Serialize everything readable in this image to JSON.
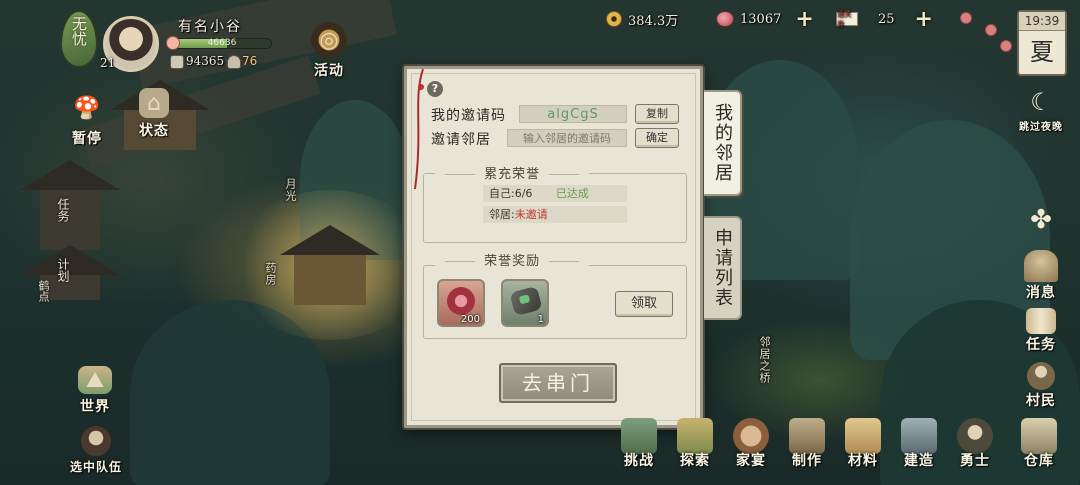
{
  "player": {
    "status_badge": "无忧",
    "name": "有名小谷",
    "level": "21",
    "exp_text": "46636",
    "exp_fraction": 0.55,
    "stat_house": "94365",
    "stat_people": "76"
  },
  "hud_left": {
    "activity": "活动",
    "pause": "暂停",
    "status": "状态",
    "task_side": "任务",
    "plan_side": "计划",
    "crane_point": "鹤点",
    "world": "世界",
    "select_team": "选中队伍"
  },
  "currency": {
    "coins": "384.3万",
    "gems": "13067",
    "tickets": "25",
    "ticket_icon_text": "通关券"
  },
  "clock": {
    "time": "19:39",
    "season": "夏"
  },
  "hud_right": {
    "skip_night": "跳过夜晚",
    "news": "消息",
    "task": "任务",
    "villagers": "村民"
  },
  "map_labels": {
    "moonlight": "月光",
    "pharmacy": "药房",
    "neighbor_bridge": "邻居之桥"
  },
  "dialog": {
    "my_code_label": "我的邀请码",
    "my_code_value": "algCgS",
    "copy_btn": "复制",
    "invite_label": "邀请邻居",
    "invite_placeholder": "输入邻居的邀请码",
    "confirm_btn": "确定",
    "honor_title": "累充荣誉",
    "self_line_label": "自己:",
    "self_line_value": "6/6",
    "self_line_status": "已达成",
    "neighbor_line_label": "邻居:",
    "neighbor_line_status": "未邀请",
    "reward_title": "荣誉奖励",
    "reward_items": [
      {
        "icon": "red-seal-icon",
        "count": "200"
      },
      {
        "icon": "jade-ore-icon",
        "count": "1"
      }
    ],
    "claim_btn": "领取",
    "visit_btn": "去串门",
    "tab_neighbors": "我的邻居",
    "tab_requests": "申请列表"
  },
  "bottom_menu": [
    "挑战",
    "探索",
    "家宴",
    "制作",
    "材料",
    "建造",
    "勇士",
    "仓库"
  ]
}
